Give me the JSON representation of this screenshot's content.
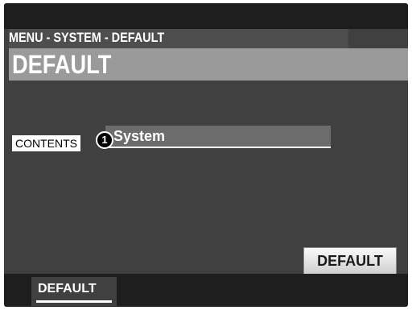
{
  "header": {
    "breadcrumb": "MENU - SYSTEM - DEFAULT",
    "title": "DEFAULT"
  },
  "main": {
    "param_label": "CONTENTS",
    "param_value": "System",
    "callout_number": "1"
  },
  "actions": {
    "default_button": "DEFAULT"
  },
  "tabs": [
    {
      "label": "DEFAULT",
      "selected": true
    }
  ]
}
